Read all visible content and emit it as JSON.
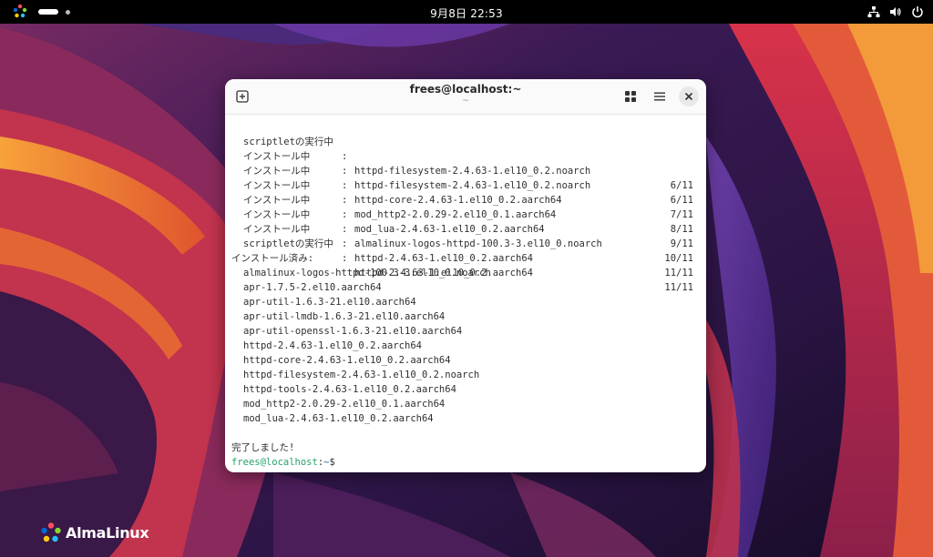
{
  "topbar": {
    "clock": "9月8日  22:53",
    "icons": [
      "almalinux-logo-icon",
      "network-icon",
      "volume-icon",
      "power-icon"
    ]
  },
  "terminal": {
    "title": "frees@localhost:~",
    "subtitle": "~",
    "transactions": [
      {
        "action": "scriptletの実行中",
        "sep": ":",
        "pkg": "httpd-filesystem-2.4.63-1.el10_0.2.noarch",
        "count": "6/11"
      },
      {
        "action": "インストール中",
        "sep": ":",
        "pkg": "httpd-filesystem-2.4.63-1.el10_0.2.noarch",
        "count": "6/11"
      },
      {
        "action": "インストール中",
        "sep": ":",
        "pkg": "httpd-core-2.4.63-1.el10_0.2.aarch64",
        "count": "7/11"
      },
      {
        "action": "インストール中",
        "sep": ":",
        "pkg": "mod_http2-2.0.29-2.el10_0.1.aarch64",
        "count": "8/11"
      },
      {
        "action": "インストール中",
        "sep": ":",
        "pkg": "mod_lua-2.4.63-1.el10_0.2.aarch64",
        "count": "9/11"
      },
      {
        "action": "インストール中",
        "sep": ":",
        "pkg": "almalinux-logos-httpd-100.3-3.el10_0.noarch",
        "count": "10/11"
      },
      {
        "action": "インストール中",
        "sep": ":",
        "pkg": "httpd-2.4.63-1.el10_0.2.aarch64",
        "count": "11/11"
      },
      {
        "action": "scriptletの実行中",
        "sep": ":",
        "pkg": "httpd-2.4.63-1.el10_0.2.aarch64",
        "count": "11/11"
      }
    ],
    "installed_heading": "インストール済み:",
    "installed": [
      "almalinux-logos-httpd-100.3-3.el10_0.noarch",
      "apr-1.7.5-2.el10.aarch64",
      "apr-util-1.6.3-21.el10.aarch64",
      "apr-util-lmdb-1.6.3-21.el10.aarch64",
      "apr-util-openssl-1.6.3-21.el10.aarch64",
      "httpd-2.4.63-1.el10_0.2.aarch64",
      "httpd-core-2.4.63-1.el10_0.2.aarch64",
      "httpd-filesystem-2.4.63-1.el10_0.2.noarch",
      "httpd-tools-2.4.63-1.el10_0.2.aarch64",
      "mod_http2-2.0.29-2.el10_0.1.aarch64",
      "mod_lua-2.4.63-1.el10_0.2.aarch64"
    ],
    "done": "完了しました!",
    "prompt": {
      "user_host": "frees@localhost",
      "colon": ":",
      "path": "~",
      "symbol": "$"
    }
  },
  "brand": {
    "name": "AlmaLinux"
  },
  "colors": {
    "topbar": "#000000",
    "prompt_user": "#26a269",
    "prompt_path": "#2f5fb3",
    "terminal_bg": "#ffffff"
  }
}
